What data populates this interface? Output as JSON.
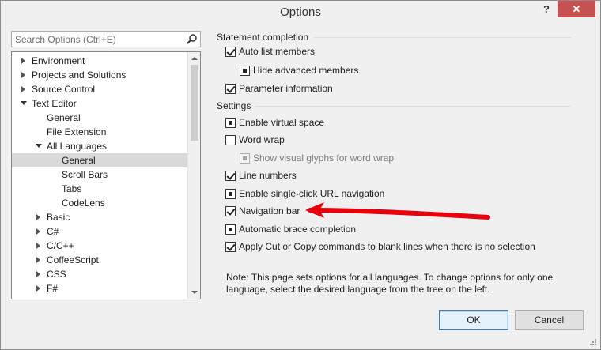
{
  "window": {
    "title": "Options",
    "help_label": "?",
    "close_label": "✕"
  },
  "search": {
    "placeholder": "Search Options (Ctrl+E)"
  },
  "tree": {
    "items": [
      {
        "label": "Environment"
      },
      {
        "label": "Projects and Solutions"
      },
      {
        "label": "Source Control"
      },
      {
        "label": "Text Editor"
      },
      {
        "label": "General"
      },
      {
        "label": "File Extension"
      },
      {
        "label": "All Languages"
      },
      {
        "label": "General"
      },
      {
        "label": "Scroll Bars"
      },
      {
        "label": "Tabs"
      },
      {
        "label": "CodeLens"
      },
      {
        "label": "Basic"
      },
      {
        "label": "C#"
      },
      {
        "label": "C/C++"
      },
      {
        "label": "CoffeeScript"
      },
      {
        "label": "CSS"
      },
      {
        "label": "F#"
      }
    ]
  },
  "statement_completion": {
    "header": "Statement completion",
    "options": [
      {
        "label": "Auto list members",
        "state": "checked"
      },
      {
        "label": "Hide advanced members",
        "state": "indeterminate"
      },
      {
        "label": "Parameter information",
        "state": "checked"
      }
    ]
  },
  "settings": {
    "header": "Settings",
    "options": [
      {
        "label": "Enable virtual space",
        "state": "indeterminate"
      },
      {
        "label": "Word wrap",
        "state": "unchecked"
      },
      {
        "label": "Show visual glyphs for word wrap",
        "state": "indeterminate-disabled"
      },
      {
        "label": "Line numbers",
        "state": "checked"
      },
      {
        "label": "Enable single-click URL navigation",
        "state": "indeterminate"
      },
      {
        "label": "Navigation bar",
        "state": "checked"
      },
      {
        "label": "Automatic brace completion",
        "state": "indeterminate"
      },
      {
        "label": "Apply Cut or Copy commands to blank lines when there is no selection",
        "state": "checked"
      }
    ]
  },
  "note": {
    "text": "Note: This page sets options for all languages. To change options for only one language, select the desired language from the tree on the left."
  },
  "buttons": {
    "ok": "OK",
    "cancel": "Cancel"
  },
  "annotation": {
    "arrow_color": "#e8000b"
  }
}
